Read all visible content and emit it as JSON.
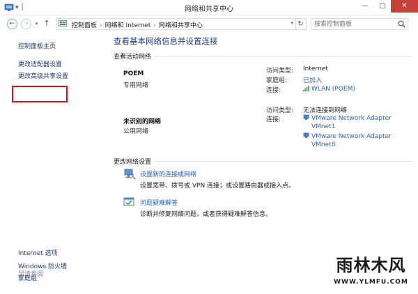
{
  "window": {
    "title": "网络和共享中心",
    "qat_glyph": "▾ │",
    "minimize_glyph": "—",
    "maximize_glyph": "▢",
    "close_glyph": "✕"
  },
  "addressbar": {
    "back_glyph": "←",
    "forward_glyph": "→",
    "history_glyph": "▾",
    "up_glyph": "↑",
    "path": [
      "控制面板",
      "网络和 Internet",
      "网络和共享中心"
    ],
    "separator": "›",
    "dropdown_glyph": "▾",
    "refresh_glyph": "↻",
    "search_placeholder": "搜索控制面板"
  },
  "sidebar": {
    "items": [
      {
        "label": "控制面板主页"
      },
      {
        "label": "更改适配器设置"
      },
      {
        "label": "更改高级共享设置"
      }
    ],
    "see_also_label": "另请参阅",
    "see_also": [
      {
        "label": "Internet 选项"
      },
      {
        "label": "Windows 防火墙"
      },
      {
        "label": "家庭组"
      }
    ]
  },
  "main": {
    "heading": "查看基本网络信息并设置连接",
    "active_networks_label": "查看活动网络",
    "networks": [
      {
        "name": "POEM",
        "type": "专用网络",
        "access_type_label": "访问类型:",
        "access_type": "Internet",
        "homegroup_label": "家庭组:",
        "homegroup": "已加入",
        "connections_label": "连接:",
        "connection": "WLAN (POEM)"
      },
      {
        "name": "未识别的网络",
        "type": "公用网络",
        "access_type_label": "访问类型:",
        "access_type": "无法连接到网络",
        "connections_label": "连接:",
        "connections": [
          "VMware Network Adapter",
          "VMnet1",
          "VMware Network Adapter",
          "VMnet8"
        ]
      }
    ],
    "change_settings_label": "更改网络设置",
    "tasks": [
      {
        "link": "设置新的连接或网络",
        "description": "设置宽带、拨号或 VPN 连接；或设置路由器或接入点。"
      },
      {
        "link": "问题疑难解答",
        "description": "诊断并修复网络问题，或者获得疑难解答信息。"
      }
    ]
  },
  "watermark": {
    "text": "雨林木风",
    "url": "WWW.YLMFU.COM"
  },
  "colors": {
    "link": "#2a63b8",
    "heading": "#1e3a8c",
    "highlight_box": "#c8171a",
    "close_button": "#c7413a"
  }
}
